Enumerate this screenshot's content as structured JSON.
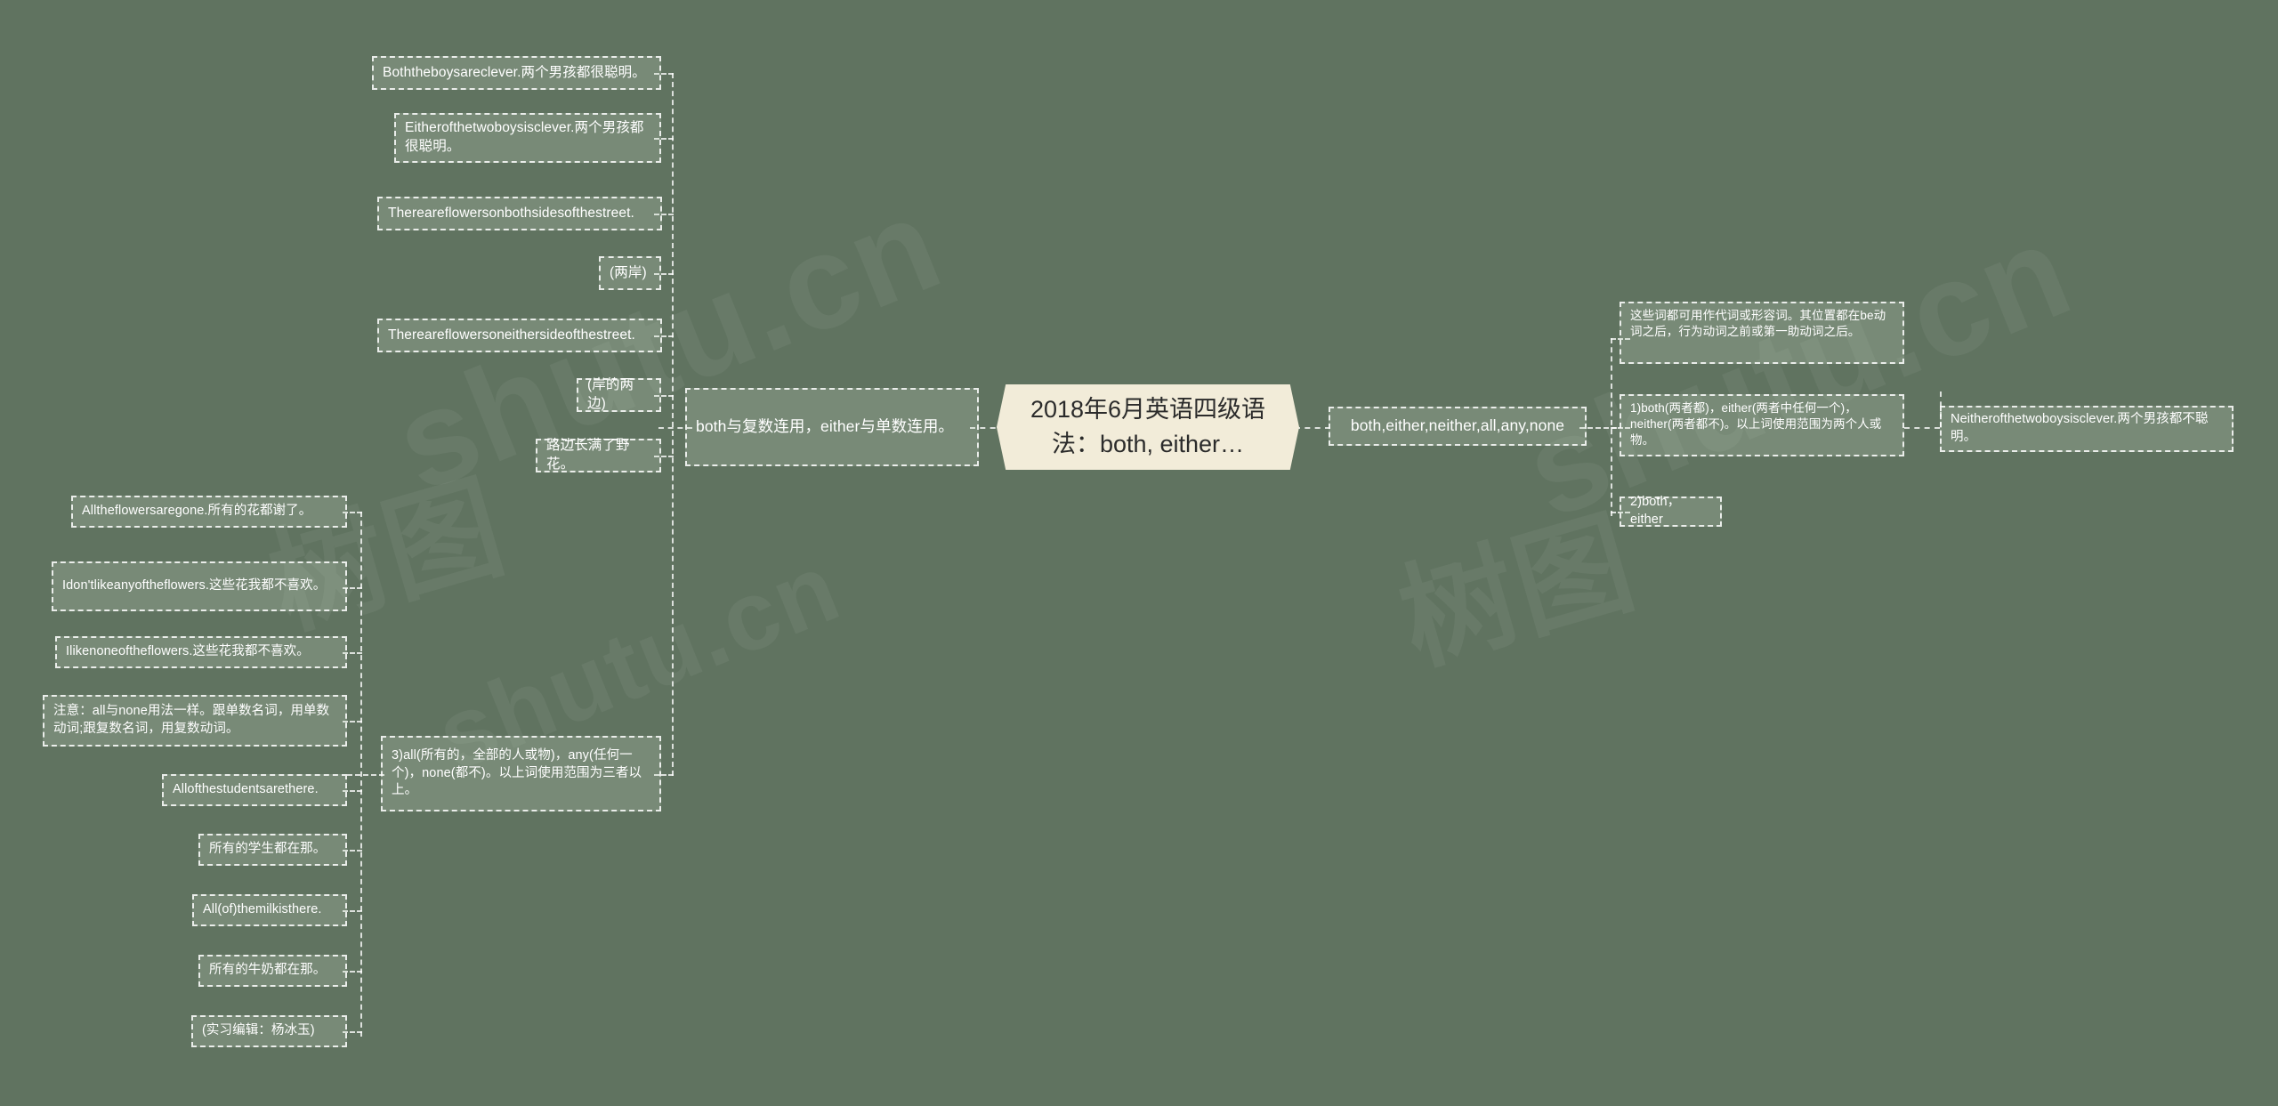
{
  "meta": {
    "background_color": "#607360",
    "node_border_color": "#ffffff",
    "node_fill_color": "rgba(205,224,200,0.22)",
    "root_fill_color": "#f2ecd9",
    "root_text_color": "#2b2b2b"
  },
  "watermarks": {
    "latin": "shutu.cn",
    "cjk": "树图"
  },
  "root": {
    "label": "2018年6月英语四级语法：both, either…"
  },
  "left_branch": {
    "label": "both与复数连用，either与单数连用。",
    "children": [
      {
        "label": "Boththeboysareclever.两个男孩都很聪明。"
      },
      {
        "label": "Eitherofthetwoboysisclever.两个男孩都很聪明。"
      },
      {
        "label": "Thereareflowersonbothsidesofthestreet."
      },
      {
        "label": "(两岸)"
      },
      {
        "label": "Thereareflowersoneithersideofthestreet."
      },
      {
        "label": "(岸的两边)"
      },
      {
        "label": "路边长满了野花。"
      },
      {
        "label": "3)all(所有的，全部的人或物)，any(任何一个)，none(都不)。以上词使用范围为三者以上。"
      }
    ]
  },
  "all_none_branch": {
    "label": "3)all(所有的，全部的人或物)，any(任何一个)，none(都不)。以上词使用范围为三者以上。",
    "children": [
      {
        "label": "Alltheflowersaregone.所有的花都谢了。"
      },
      {
        "label": "Idon'tlikeanyoftheflowers.这些花我都不喜欢。"
      },
      {
        "label": "Ilikenoneoftheflowers.这些花我都不喜欢。"
      },
      {
        "label": "注意：all与none用法一样。跟单数名词，用单数动词;跟复数名词，用复数动词。"
      },
      {
        "label": "Allofthestudentsarethere."
      },
      {
        "label": "所有的学生都在那。"
      },
      {
        "label": "All(of)themilkisthere."
      },
      {
        "label": "所有的牛奶都在那。"
      },
      {
        "label": "(实习编辑：杨冰玉)"
      }
    ]
  },
  "right_branch": {
    "label": "both,either,neither,all,any,none",
    "children": [
      {
        "label": "这些词都可用作代词或形容词。其位置都在be动词之后，行为动词之前或第一助动词之后。"
      },
      {
        "label": "1)both(两者都)，either(两者中任何一个)，neither(两者都不)。以上词使用范围为两个人或物。"
      },
      {
        "label": "2)both，either"
      }
    ]
  },
  "far_right": {
    "label": "Neitherofthetwoboysisclever.两个男孩都不聪明。"
  }
}
